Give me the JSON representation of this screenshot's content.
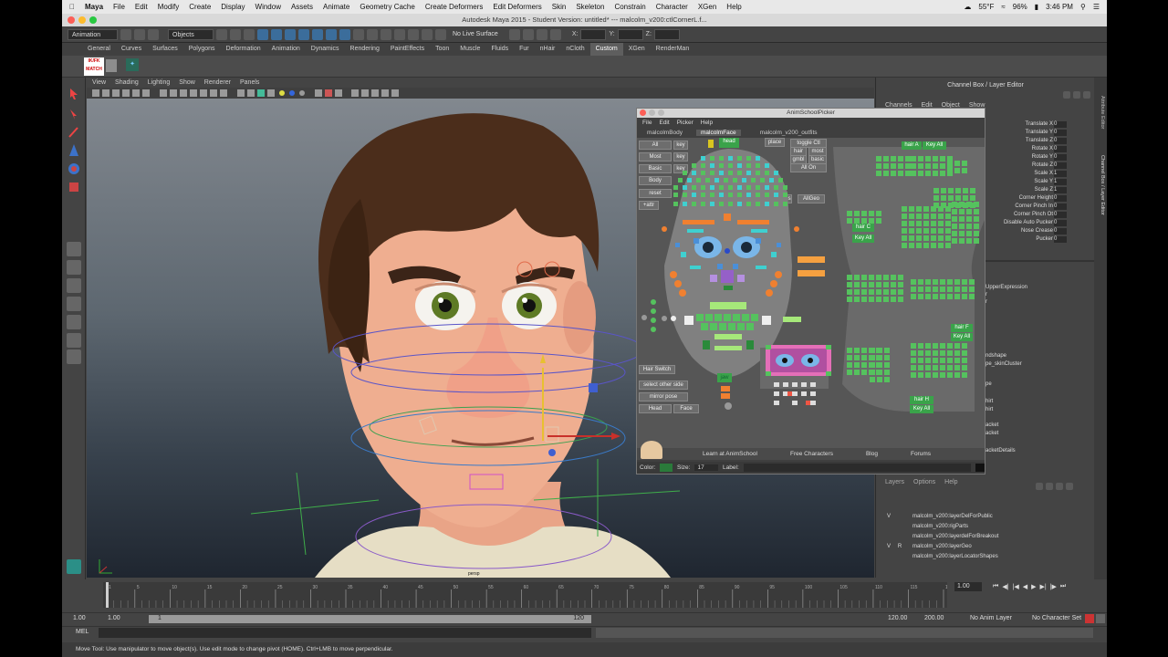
{
  "mac_menu": {
    "app": "Maya",
    "items": [
      "File",
      "Edit",
      "Modify",
      "Create",
      "Display",
      "Window",
      "Assets",
      "Animate",
      "Geometry Cache",
      "Create Deformers",
      "Edit Deformers",
      "Skin",
      "Skeleton",
      "Constrain",
      "Character",
      "XGen",
      "Help"
    ],
    "battery": "96%",
    "temp": "55°F",
    "time": "3:46 PM"
  },
  "window_title": "Autodesk Maya 2015 - Student Version: untitled* --- malcolm_v200:ctlCornerL.f...",
  "status_line": {
    "mode": "Animation",
    "selection_mask": "Objects",
    "live_surface": "No Live Surface",
    "x_label": "X:",
    "y_label": "Y:",
    "z_label": "Z:"
  },
  "shelf_tabs": [
    "General",
    "Curves",
    "Surfaces",
    "Polygons",
    "Deformation",
    "Animation",
    "Dynamics",
    "Rendering",
    "PaintEffects",
    "Toon",
    "Muscle",
    "Fluids",
    "Fur",
    "nHair",
    "nCloth",
    "Custom",
    "XGen",
    "RenderMan"
  ],
  "shelf_active": "Custom",
  "shelf_logo": "IK/FK MATCH",
  "viewport_menu": [
    "View",
    "Shading",
    "Lighting",
    "Show",
    "Renderer",
    "Panels"
  ],
  "viewport_label": "persp",
  "channel_box": {
    "header": "Channel Box / Layer Editor",
    "menu": [
      "Channels",
      "Edit",
      "Object",
      "Show"
    ],
    "attributes": [
      "Translate X",
      "Translate Y",
      "Translate Z",
      "Rotate X",
      "Rotate Y",
      "Rotate Z",
      "Scale X",
      "Scale Y",
      "Scale Z",
      "Corner Height",
      "Corner Pinch In",
      "Corner Pinch Ot",
      "Disable Auto Pucker",
      "Nose Crease",
      "Pucker"
    ],
    "values": [
      "0",
      "0",
      "0",
      "0",
      "0",
      "0",
      "1",
      "1",
      "1",
      "0",
      "0",
      "0",
      "0",
      "0",
      "0"
    ],
    "partial_names": [
      "UpperExpression",
      "r",
      "r",
      "ndshape",
      "pe_skinCluster",
      "pe",
      "hirt",
      "hirt",
      "acket",
      "acket",
      "acketDetails"
    ]
  },
  "layer_editor": {
    "menu": [
      "Layers",
      "Options",
      "Help"
    ],
    "layers": [
      {
        "v": "V",
        "r": "",
        "name": "malcolm_v200:layerDelForPublic"
      },
      {
        "v": "",
        "r": "",
        "name": "malcolm_v200:rigParts"
      },
      {
        "v": "",
        "r": "",
        "name": "malcolm_v200:layerdelForBreakout"
      },
      {
        "v": "V",
        "r": "R",
        "name": "malcolm_v200:layerGeo"
      },
      {
        "v": "",
        "r": "",
        "name": "malcolm_v200:layerLocatorShapes"
      }
    ]
  },
  "side_tabs": [
    "Attribute Editor",
    "Channel Box / Layer Editor"
  ],
  "picker": {
    "title": "AnimSchoolPicker",
    "menu": [
      "File",
      "Edit",
      "Picker",
      "Help"
    ],
    "tabs": [
      "malcolmBody",
      "malcolmFace",
      "malcolm_v200_outfits"
    ],
    "active_tab": "malcolmFace",
    "left_buttons": [
      {
        "a": "All",
        "b": "key"
      },
      {
        "a": "Most",
        "b": "key"
      },
      {
        "a": "Basic",
        "b": "key"
      },
      {
        "a": "Body",
        "b": ""
      },
      {
        "a": "reset",
        "b": ""
      },
      {
        "a": "+attr",
        "b": ""
      }
    ],
    "top_buttons": [
      "toggle Ctl",
      "hair",
      "most",
      "gmbl",
      "basic",
      "All On"
    ],
    "head_label": "head",
    "place_label": "place",
    "eyes_label": "Eyes",
    "allgeo_label": "AllGeo",
    "jaw_label": "jaw",
    "lower_buttons": [
      "Hair Switch",
      "select other side",
      "mirror pose",
      "Head",
      "Face"
    ],
    "hair_labels": [
      {
        "a": "hair A",
        "b": "Key All"
      },
      {
        "a": "hair C",
        "b": "Key All"
      },
      {
        "a": "hair F",
        "b": "Key All"
      },
      {
        "a": "hair H",
        "b": "Key All"
      }
    ],
    "bottom_links": [
      "Learn at AnimSchool",
      "Free Characters",
      "Blog",
      "Forums"
    ],
    "color_label": "Color:",
    "size_label": "Size:",
    "size_value": "17",
    "label_label": "Label:"
  },
  "timeline": {
    "ticks": [
      "1",
      "5",
      "10",
      "15",
      "20",
      "25",
      "30",
      "35",
      "40",
      "45",
      "50",
      "55",
      "60",
      "65",
      "70",
      "75",
      "80",
      "85",
      "90",
      "95",
      "100",
      "105",
      "110",
      "115",
      "120"
    ],
    "current": "1.00",
    "range_start": "1.00",
    "range_inner_start": "1.00",
    "range_inner_marker": "1",
    "range_inner_end": "120",
    "range_end": "120.00",
    "range_max": "200.00",
    "anim_layer": "No Anim Layer",
    "char_set": "No Character Set",
    "mel_label": "MEL"
  },
  "help_line": "Move Tool: Use manipulator to move object(s). Use edit mode to change pivot (HOME). Ctrl+LMB to move perpendicular.",
  "colors": {
    "accent": "#5c9bd6",
    "picker_green": "#55c25e",
    "picker_blue": "#4a8fd8",
    "picker_cyan": "#3fd0d0",
    "picker_orange": "#f08030",
    "picker_purple": "#9560c8",
    "picker_pink": "#e46fb8"
  }
}
